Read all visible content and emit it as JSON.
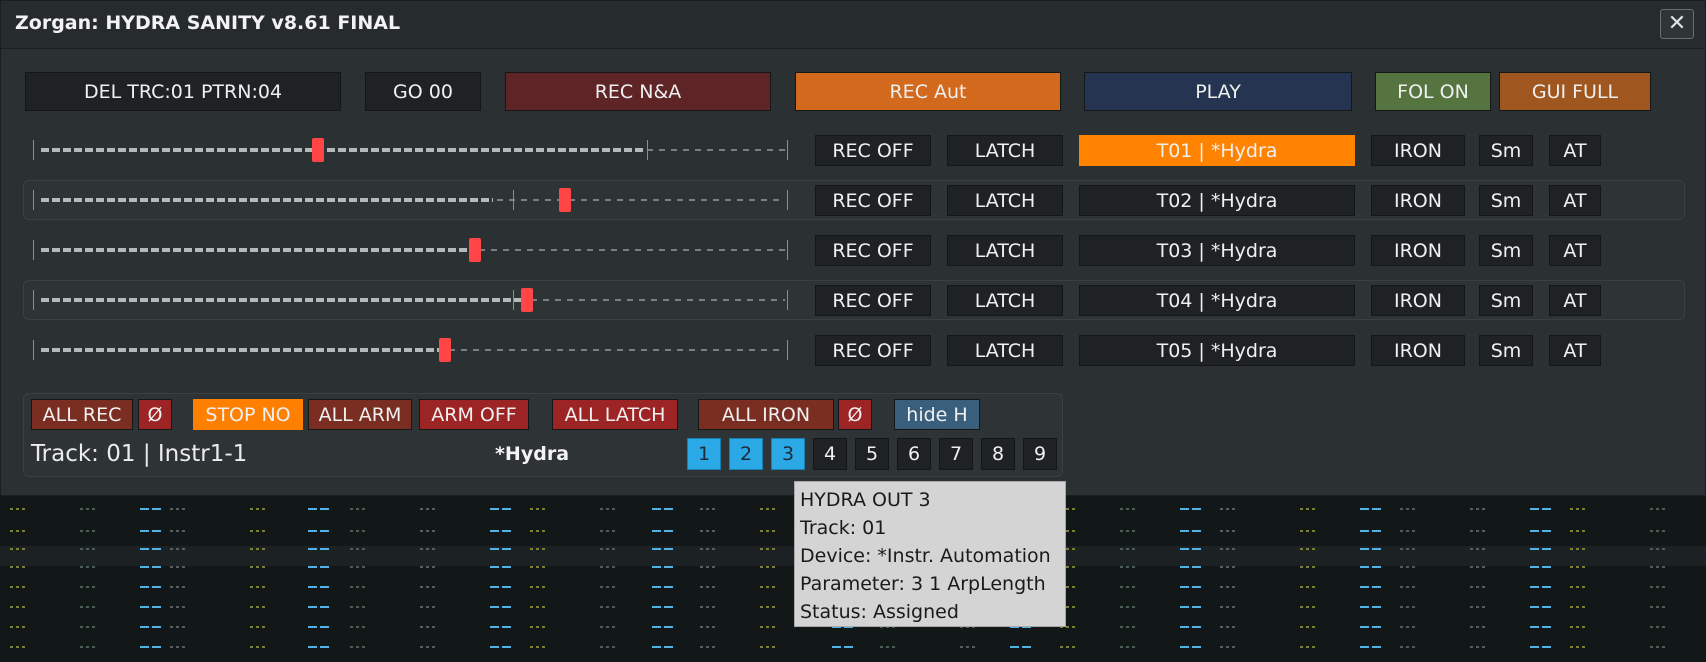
{
  "window": {
    "title": "Zorgan: HYDRA SANITY v8.61 FINAL",
    "close_label": "✕"
  },
  "toolbar": {
    "del_label": "DEL TRC:01 PTRN:04",
    "go_label": "GO 00",
    "rec_na_label": "REC N&A",
    "rec_aut_label": "REC Aut",
    "play_label": "PLAY",
    "fol_label": "FOL ON",
    "gui_label": "GUI FULL"
  },
  "tracks": [
    {
      "rec": "REC OFF",
      "latch": "LATCH",
      "name": "T01 | *Hydra",
      "iron": "IRON",
      "sm": "Sm",
      "at": "AT",
      "value": 0.37
    },
    {
      "rec": "REC OFF",
      "latch": "LATCH",
      "name": "T02 | *Hydra",
      "iron": "IRON",
      "sm": "Sm",
      "at": "AT",
      "value": 0.7
    },
    {
      "rec": "REC OFF",
      "latch": "LATCH",
      "name": "T03 | *Hydra",
      "iron": "IRON",
      "sm": "Sm",
      "at": "AT",
      "value": 0.58
    },
    {
      "rec": "REC OFF",
      "latch": "LATCH",
      "name": "T04 | *Hydra",
      "iron": "IRON",
      "sm": "Sm",
      "at": "AT",
      "value": 0.65
    },
    {
      "rec": "REC OFF",
      "latch": "LATCH",
      "name": "T05 | *Hydra",
      "iron": "IRON",
      "sm": "Sm",
      "at": "AT",
      "value": 0.54
    }
  ],
  "bottom": {
    "all_rec": "ALL REC",
    "null1": "Ø",
    "stop_no": "STOP NO",
    "all_arm": "ALL ARM",
    "arm_off": "ARM OFF",
    "all_latch": "ALL LATCH",
    "all_iron": "ALL IRON",
    "null2": "Ø",
    "hide_h": "hide H",
    "track_info": "Track: 01 | Instr1-1",
    "device": "*Hydra",
    "numbers": [
      "1",
      "2",
      "3",
      "4",
      "5",
      "6",
      "7",
      "8",
      "9"
    ],
    "numbers_active": [
      1,
      2,
      3
    ]
  },
  "tooltip": {
    "line1": "HYDRA OUT 3",
    "line2": "Track: 01",
    "line3": "Device: *Instr. Automation",
    "line4": "Parameter: 3 1 ArpLength",
    "line5": "Status: Assigned"
  },
  "colors": {
    "accent_orange": "#ff8200",
    "active_blue": "#2aa9e6",
    "handle_red": "#ff4545"
  }
}
